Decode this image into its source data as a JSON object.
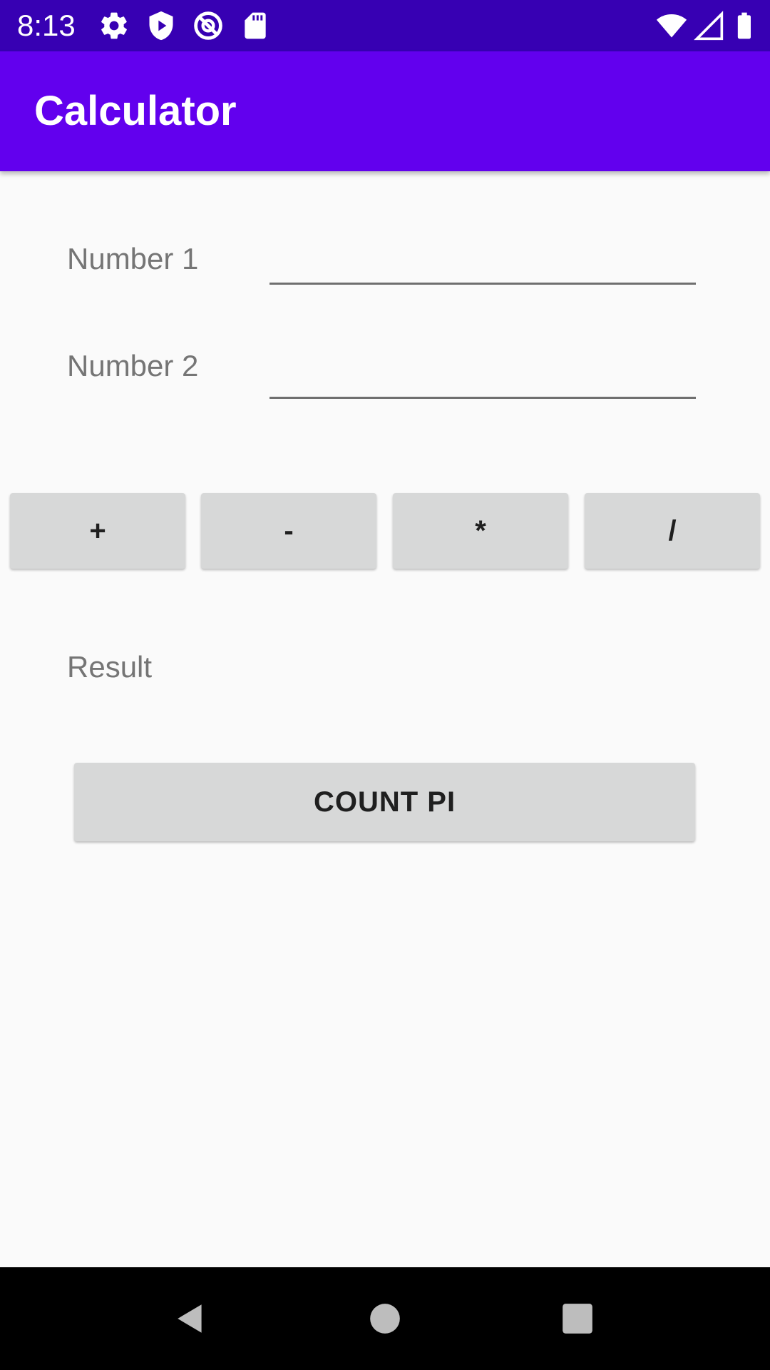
{
  "status_bar": {
    "time": "8:13",
    "left_icons": [
      "gear-icon",
      "play-shield-icon",
      "at-sign-icon",
      "sd-card-icon"
    ],
    "right_icons": [
      "wifi-icon",
      "cell-signal-icon",
      "battery-icon"
    ]
  },
  "app_bar": {
    "title": "Calculator",
    "color": "#6200ee",
    "status_color": "#3700b3"
  },
  "form": {
    "number1_label": "Number 1",
    "number1_value": "",
    "number2_label": "Number 2",
    "number2_value": ""
  },
  "operations": [
    {
      "label": "+"
    },
    {
      "label": "-"
    },
    {
      "label": "*"
    },
    {
      "label": "/"
    }
  ],
  "result_label": "Result",
  "count_pi_label": "COUNT PI",
  "nav_bar": {
    "buttons": [
      "back-icon",
      "home-icon",
      "recents-icon"
    ]
  }
}
